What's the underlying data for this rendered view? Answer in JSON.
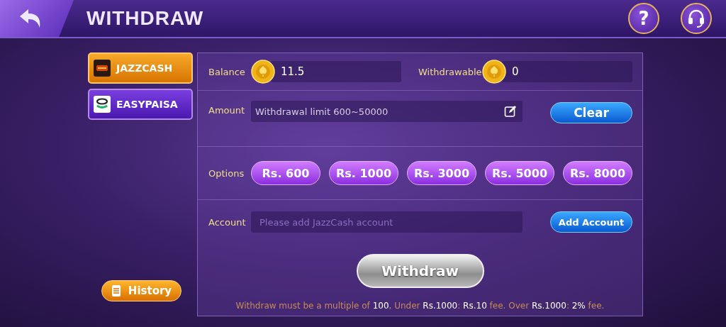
{
  "header": {
    "title": "WITHDRAW",
    "help_label": "?"
  },
  "methods": [
    {
      "label": "JAZZCASH",
      "selected": true,
      "kind": "jazzcash"
    },
    {
      "label": "EASYPAISA",
      "selected": false,
      "kind": "easypaisa"
    }
  ],
  "history_button": "History",
  "balance": {
    "label": "Balance",
    "value": "11.5"
  },
  "withdrawable": {
    "label": "Withdrawable",
    "value": "0"
  },
  "amount": {
    "label": "Amount",
    "placeholder": "Withdrawal limit 600~50000"
  },
  "clear_button": "Clear",
  "options": {
    "label": "Options",
    "items": [
      {
        "label": "Rs. 600",
        "selected": false
      },
      {
        "label": "Rs. 1000",
        "selected": false
      },
      {
        "label": "Rs. 3000",
        "selected": false
      },
      {
        "label": "Rs. 5000",
        "selected": false
      },
      {
        "label": "Rs. 8000",
        "selected": false
      }
    ]
  },
  "account": {
    "label": "Account",
    "placeholder": "Please add JazzCash account"
  },
  "add_account_button": "Add Account",
  "withdraw_button": "Withdraw",
  "note": [
    {
      "text": "Withdraw must be a multiple of ",
      "highlight": false
    },
    {
      "text": "100",
      "highlight": true
    },
    {
      "text": ", Under ",
      "highlight": false
    },
    {
      "text": "Rs.1000",
      "highlight": true
    },
    {
      "text": ": ",
      "highlight": false
    },
    {
      "text": "Rs.10",
      "highlight": true
    },
    {
      "text": " fee. Over ",
      "highlight": false
    },
    {
      "text": "Rs.1000",
      "highlight": true
    },
    {
      "text": ": ",
      "highlight": false
    },
    {
      "text": "2%",
      "highlight": true
    },
    {
      "text": " fee.",
      "highlight": false
    }
  ]
}
